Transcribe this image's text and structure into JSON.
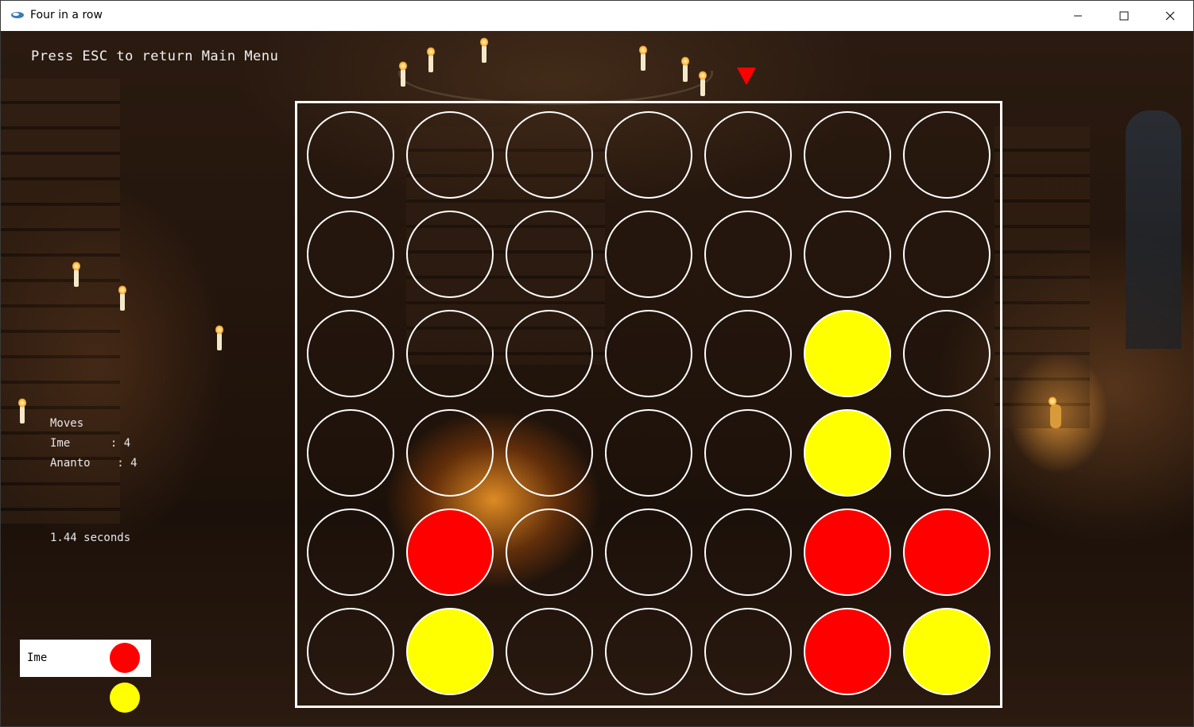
{
  "window": {
    "title": "Four in a row",
    "minimize_icon": "minimize-icon",
    "maximize_icon": "maximize-icon",
    "close_icon": "close-icon"
  },
  "hint": "Press ESC to return Main Menu",
  "colors": {
    "red": "#ff0000",
    "yellow": "#ffff00",
    "grid": "#ffffff",
    "marker": "#ff0000"
  },
  "drop_marker": {
    "column": 4,
    "icon": "down-triangle-icon",
    "color": "#ff0000"
  },
  "board": {
    "columns": 7,
    "rows": 6,
    "cells": [
      [
        "",
        "",
        "",
        "",
        "",
        "",
        ""
      ],
      [
        "",
        "",
        "",
        "",
        "",
        "",
        ""
      ],
      [
        "",
        "",
        "",
        "",
        "",
        "yellow",
        ""
      ],
      [
        "",
        "",
        "",
        "",
        "",
        "yellow",
        ""
      ],
      [
        "",
        "red",
        "",
        "",
        "",
        "red",
        "red"
      ],
      [
        "",
        "yellow",
        "",
        "",
        "",
        "red",
        "yellow"
      ]
    ]
  },
  "stats": {
    "header": "Moves",
    "rows": [
      {
        "text": "Ime      : 4"
      },
      {
        "text": "Ananto    : 4"
      }
    ]
  },
  "timer": "1.44 seconds",
  "current_player": {
    "name": "Ime",
    "color": "red"
  },
  "next_token_color": "yellow"
}
